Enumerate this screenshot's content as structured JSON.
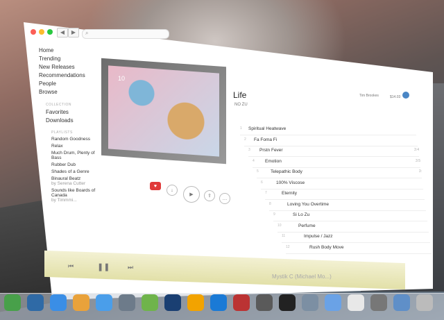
{
  "window": {
    "search_placeholder": "",
    "nav": [
      "Home",
      "Trending",
      "New Releases",
      "Recommendations",
      "People",
      "Browse"
    ],
    "collection_header": "COLLECTION",
    "collection": [
      "Favorites",
      "Downloads"
    ],
    "playlists_header": "PLAYLISTS",
    "playlists": [
      {
        "title": "Random Goodness",
        "by": ""
      },
      {
        "title": "Relax",
        "by": ""
      },
      {
        "title": "Much Drum, Plenty of Bass",
        "by": ""
      },
      {
        "title": "Rubber Dub",
        "by": ""
      },
      {
        "title": "Shades of a Genre",
        "by": ""
      },
      {
        "title": "Binaural Beatz",
        "by": "by Serena Cutter"
      },
      {
        "title": "Sounds like Boards of Canada",
        "by": "by Timmmi..."
      }
    ]
  },
  "album": {
    "art_number_top": "10",
    "art_number_bottom": "10",
    "title": "Life",
    "artist": "NO ZU",
    "user": "Tim Brookes",
    "balance": "$14.03"
  },
  "tracks": [
    {
      "num": "1",
      "title": "Spiritual Heatwave",
      "dur": ""
    },
    {
      "num": "2",
      "title": "Fa Foma Fi",
      "dur": ""
    },
    {
      "num": "3",
      "title": "Prstn Fever",
      "dur": "3:4"
    },
    {
      "num": "4",
      "title": "Emotion",
      "dur": "3:5"
    },
    {
      "num": "5",
      "title": "Telepathic Body",
      "dur": "3:"
    },
    {
      "num": "6",
      "title": "100% Viscose",
      "dur": ""
    },
    {
      "num": "7",
      "title": "Eternity",
      "dur": ""
    },
    {
      "num": "8",
      "title": "Loving You Overtime",
      "dur": ""
    },
    {
      "num": "9",
      "title": "Si Lo Zu",
      "dur": ""
    },
    {
      "num": "10",
      "title": "Perfume",
      "dur": ""
    },
    {
      "num": "11",
      "title": "Impulse / Jazz",
      "dur": ""
    },
    {
      "num": "12",
      "title": "Rush Body Move",
      "dur": ""
    }
  ],
  "player": {
    "now_playing": "Mystik C (Michael Mo...)"
  },
  "dock": [
    "Mint",
    "Trello",
    "Safari",
    "Chrome",
    "Messages",
    "Photo Booth",
    "Evernote",
    "Photoshop",
    "Sublime",
    "Tower",
    "Scripts",
    "Finder",
    "Terminal",
    "Preview",
    "Folder",
    "Doc",
    "Image",
    "Downloads",
    "Trash"
  ],
  "colors": {
    "accent": "#e03a3a",
    "avatar": "#4a86c5",
    "player_bg": "#e8e6b8"
  }
}
